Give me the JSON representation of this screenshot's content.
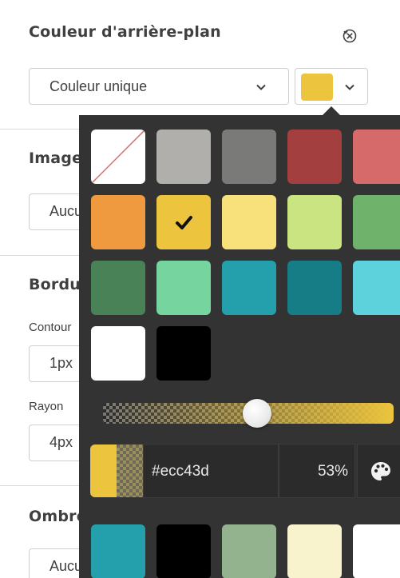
{
  "panel": {
    "background_title": "Couleur d'arrière-plan",
    "fill_mode": "Couleur unique",
    "selected_color": "#ecc43d",
    "image_title": "Image",
    "image_value": "Aucune",
    "border_title": "Bordure",
    "contour_label": "Contour",
    "contour_value": "1px",
    "radius_label": "Rayon",
    "radius_value": "4px",
    "shadow_title": "Ombre",
    "shadow_value": "Aucune"
  },
  "colors": {
    "accent": "#ecc43d",
    "popover_bg": "#333333"
  },
  "picker": {
    "swatches": [
      {
        "name": "transparent",
        "color": "#ffffff"
      },
      {
        "name": "light-gray",
        "color": "#b0afac"
      },
      {
        "name": "dark-gray",
        "color": "#7a7a78"
      },
      {
        "name": "dark-red",
        "color": "#a33f3f"
      },
      {
        "name": "light-red",
        "color": "#d66a6a"
      },
      {
        "name": "orange",
        "color": "#ef9a3f"
      },
      {
        "name": "yellow",
        "color": "#ecc43d",
        "selected": true
      },
      {
        "name": "light-yellow",
        "color": "#f8e07a"
      },
      {
        "name": "light-green",
        "color": "#c9e481"
      },
      {
        "name": "green",
        "color": "#6fb26c"
      },
      {
        "name": "dark-green",
        "color": "#4a8258"
      },
      {
        "name": "mint",
        "color": "#76d49e"
      },
      {
        "name": "teal",
        "color": "#23a0ac"
      },
      {
        "name": "dark-teal",
        "color": "#167c86"
      },
      {
        "name": "cyan",
        "color": "#5ed2dc"
      },
      {
        "name": "white",
        "color": "#ffffff"
      },
      {
        "name": "black",
        "color": "#000000"
      }
    ],
    "opacity_percent": 53,
    "hex_value": "#ecc43d",
    "opacity_text": "53%",
    "recent_colors": [
      {
        "color": "#23a0ac"
      },
      {
        "color": "#000000"
      },
      {
        "color": "#93b38f"
      },
      {
        "color": "#f8f3cd"
      },
      {
        "color": "#ffffff"
      }
    ]
  }
}
